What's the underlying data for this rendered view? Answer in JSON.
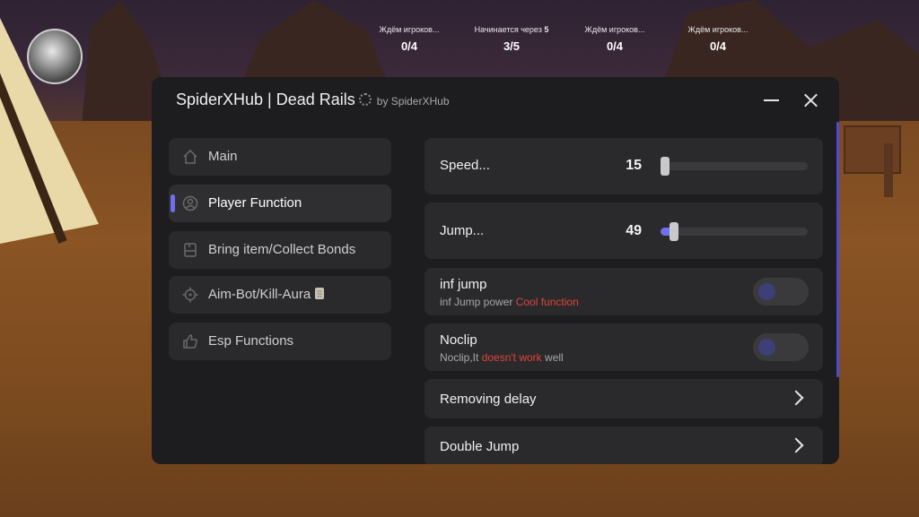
{
  "hud": {
    "slots": [
      {
        "label": "Ждём игроков...",
        "count": "0/4"
      },
      {
        "label": "Начинается через",
        "label_extra": "5",
        "count": "3/5"
      },
      {
        "label": "Ждём игроков...",
        "count": "0/4"
      },
      {
        "label": "Ждём игроков...",
        "count": "0/4"
      }
    ]
  },
  "window": {
    "title": "SpiderXHub | Dead Rails",
    "subtitle": "by SpiderXHub"
  },
  "sidebar": {
    "accent": "#6f6ff0",
    "items": [
      {
        "label": "Main",
        "icon": "home-icon",
        "active": false
      },
      {
        "label": "Player Function",
        "icon": "user-icon",
        "active": true
      },
      {
        "label": "Bring item/Collect Bonds",
        "icon": "package-icon",
        "active": false
      },
      {
        "label": "Aim-Bot/Kill-Aura",
        "icon": "crosshair-icon",
        "extra_icon": "scroll-emoji-icon",
        "active": false
      },
      {
        "label": "Esp Functions",
        "icon": "thumbs-up-icon",
        "active": false
      }
    ]
  },
  "content": {
    "speed": {
      "label": "Speed...",
      "value": "15",
      "fraction": 0.0
    },
    "jump": {
      "label": "Jump...",
      "value": "49",
      "fraction": 0.09
    },
    "inf_jump": {
      "label": "inf jump",
      "desc_prefix": "inf Jump power ",
      "desc_highlight": "Cool function",
      "desc_suffix": "",
      "enabled": false
    },
    "noclip": {
      "label": "Noclip",
      "desc_prefix": "Noclip,It ",
      "desc_highlight": "doesn't work",
      "desc_suffix": " well",
      "enabled": false
    },
    "removing_delay": {
      "label": "Removing delay"
    },
    "double_jump": {
      "label": "Double Jump"
    }
  },
  "colors": {
    "highlight": "#e0443a",
    "accent": "#6f6ff0"
  }
}
